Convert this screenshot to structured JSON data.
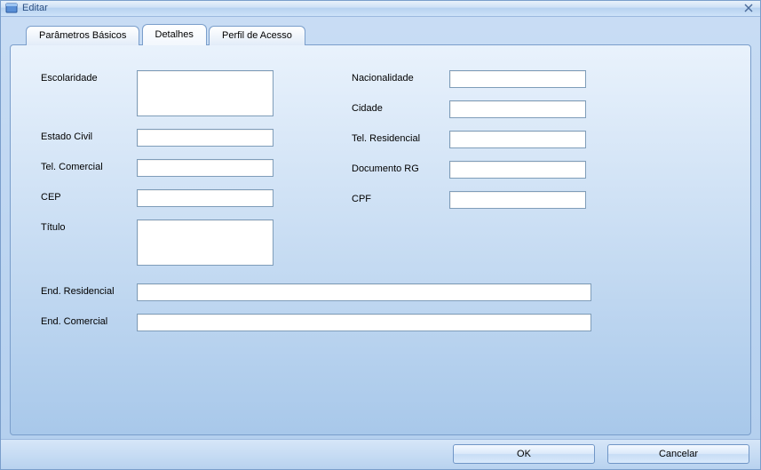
{
  "window": {
    "title": "Editar"
  },
  "tabs": {
    "basic": "Parâmetros Básicos",
    "details": "Detalhes",
    "access": "Perfil de Acesso"
  },
  "labels": {
    "escolaridade": "Escolaridade",
    "estado_civil": "Estado Civil",
    "tel_comercial": "Tel. Comercial",
    "cep": "CEP",
    "titulo": "Título",
    "nacionalidade": "Nacionalidade",
    "cidade": "Cidade",
    "tel_residencial": "Tel. Residencial",
    "documento_rg": "Documento RG",
    "cpf": "CPF",
    "end_residencial": "End. Residencial",
    "end_comercial": "End. Comercial"
  },
  "values": {
    "escolaridade": "",
    "estado_civil": "",
    "tel_comercial": "",
    "cep": "",
    "titulo": "",
    "nacionalidade": "",
    "cidade": "",
    "tel_residencial": "",
    "documento_rg": "",
    "cpf": "",
    "end_residencial": "",
    "end_comercial": ""
  },
  "buttons": {
    "ok": "OK",
    "cancel": "Cancelar"
  }
}
